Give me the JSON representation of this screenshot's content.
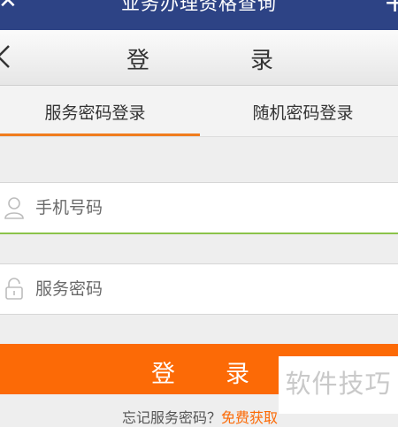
{
  "top_bar": {
    "title": "业务办理资格查询"
  },
  "login_header": {
    "title_part1": "登",
    "title_part2": "录"
  },
  "tabs": [
    {
      "label": "服务密码登录",
      "active": true
    },
    {
      "label": "随机密码登录",
      "active": false
    }
  ],
  "fields": {
    "phone_placeholder": "手机号码",
    "password_placeholder": "服务密码"
  },
  "login_button": {
    "char1": "登",
    "char2": "录"
  },
  "footer": {
    "text": "忘记服务密码",
    "separator": "？",
    "link": "免费获取"
  },
  "watermark": "软件技巧",
  "colors": {
    "topbar": "#2d4385",
    "accent": "#fc6a06",
    "tab_indicator": "#f07c1d",
    "active_field_border": "#8bc34a"
  }
}
